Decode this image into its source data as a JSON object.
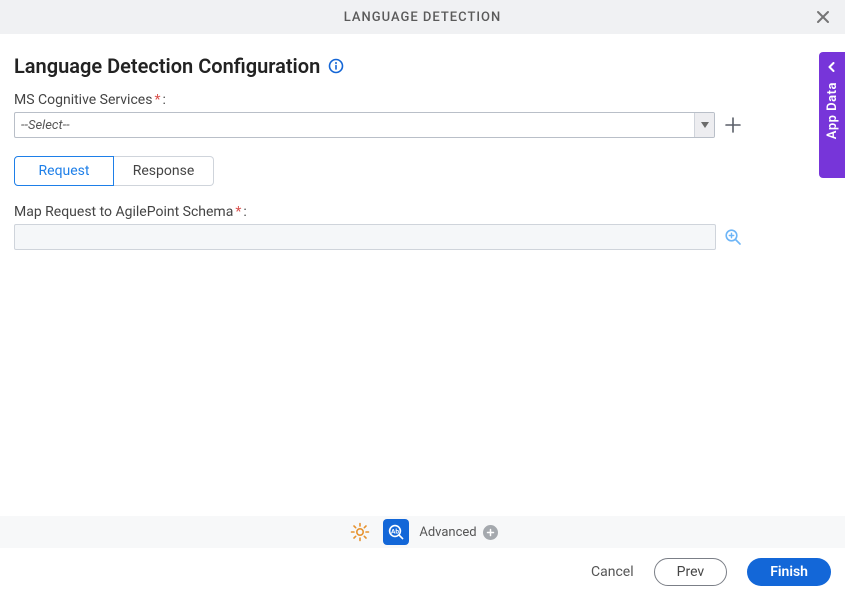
{
  "header": {
    "title": "LANGUAGE DETECTION"
  },
  "main": {
    "title": "Language Detection Configuration",
    "field1": {
      "label": "MS Cognitive Services",
      "colon": ":",
      "select_value": "--Select--"
    },
    "tabs": {
      "request": "Request",
      "response": "Response"
    },
    "field2": {
      "label": "Map Request to AgilePoint Schema",
      "colon": ":"
    }
  },
  "side_tab": {
    "label": "App Data"
  },
  "bottom": {
    "advanced_label": "Advanced"
  },
  "footer": {
    "cancel": "Cancel",
    "prev": "Prev",
    "finish": "Finish"
  }
}
